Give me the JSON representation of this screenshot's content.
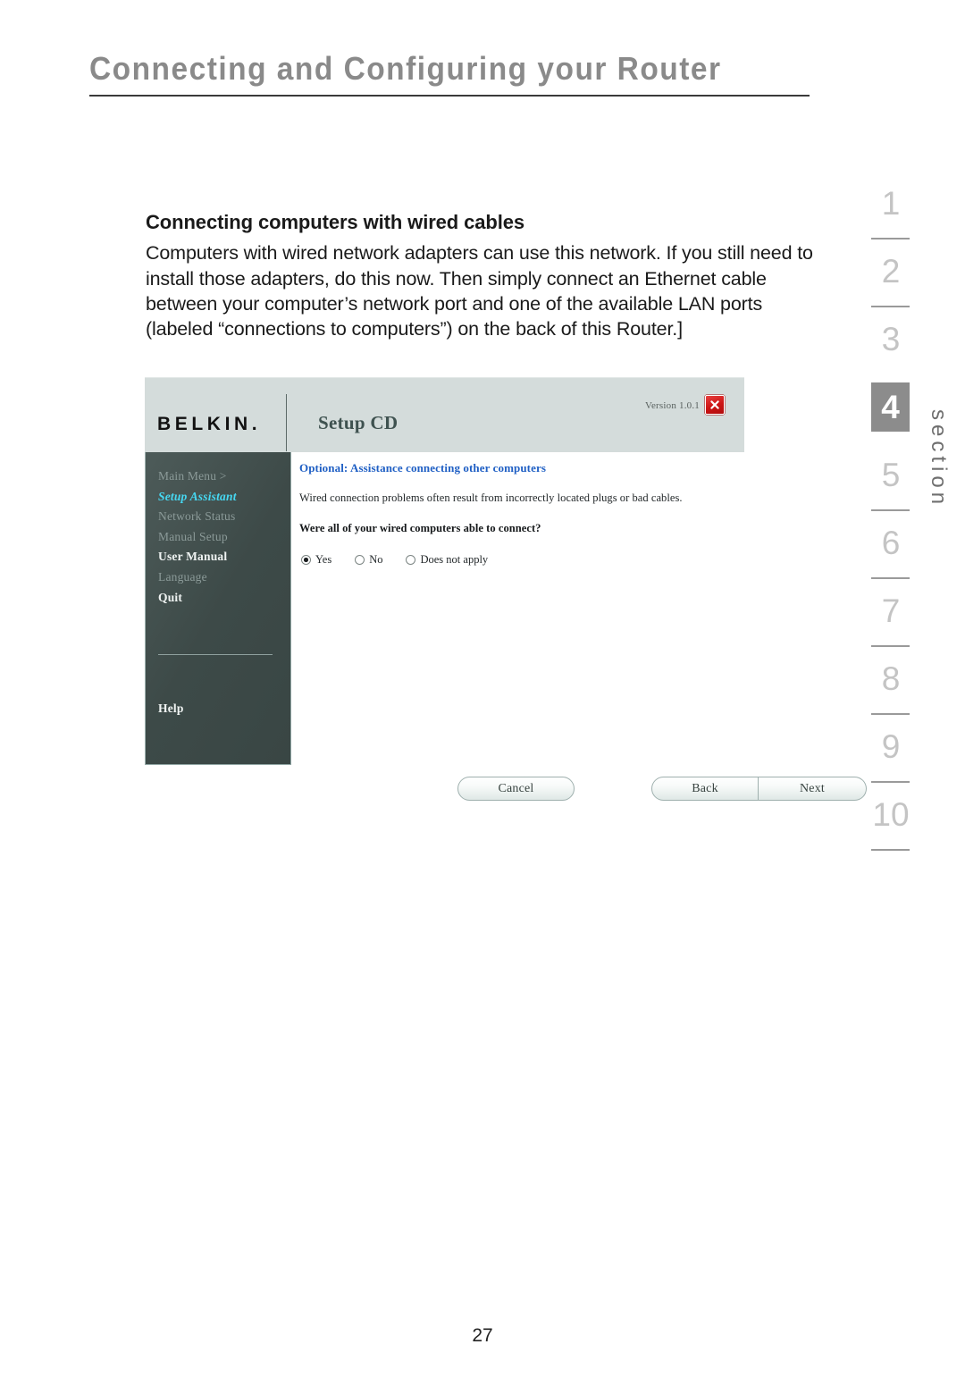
{
  "page": {
    "running_head": "Connecting and Configuring your Router",
    "page_number": "27"
  },
  "content": {
    "heading": "Connecting computers with wired cables",
    "paragraph": "Computers with wired network adapters can use this network. If you still need to install those adapters, do this now. Then simply connect an Ethernet cable between your computer’s network port and one of the available LAN ports (labeled “connections to computers”) on the back of this Router.]"
  },
  "app_screenshot": {
    "titlebar": {
      "brand": "BELKIN.",
      "title": "Setup CD",
      "version": "Version 1.0.1",
      "close_icon": "close-icon",
      "close_glyph": "✕",
      "background_color": "#d4dcdb"
    },
    "sidebar": {
      "background_color": "#3d4a48",
      "items": [
        {
          "label": "Main Menu  >",
          "state": "dim"
        },
        {
          "label": "Setup Assistant",
          "state": "active"
        },
        {
          "label": "Network Status",
          "state": "dim"
        },
        {
          "label": "Manual Setup",
          "state": "dim"
        },
        {
          "label": "User Manual",
          "state": "bold"
        },
        {
          "label": "Language",
          "state": "dim"
        },
        {
          "label": "Quit",
          "state": "bold"
        }
      ],
      "help_label": "Help",
      "active_color": "#46d8f2"
    },
    "panel": {
      "heading": "Optional: Assistance connecting other computers",
      "heading_color": "#1f5fc4",
      "description": "Wired connection problems often result from incorrectly located plugs or bad cables.",
      "question": "Were all of your wired computers able to connect?",
      "radio_options": [
        {
          "label": "Yes",
          "selected": true
        },
        {
          "label": "No",
          "selected": false
        },
        {
          "label": "Does not apply",
          "selected": false
        }
      ],
      "buttons": {
        "cancel": "Cancel",
        "back": "Back",
        "next": "Next"
      }
    }
  },
  "section_rail": {
    "label": "section",
    "current": "4",
    "numbers": [
      "1",
      "2",
      "3",
      "4",
      "5",
      "6",
      "7",
      "8",
      "9",
      "10"
    ],
    "highlight_color": "#8c8c8c"
  }
}
